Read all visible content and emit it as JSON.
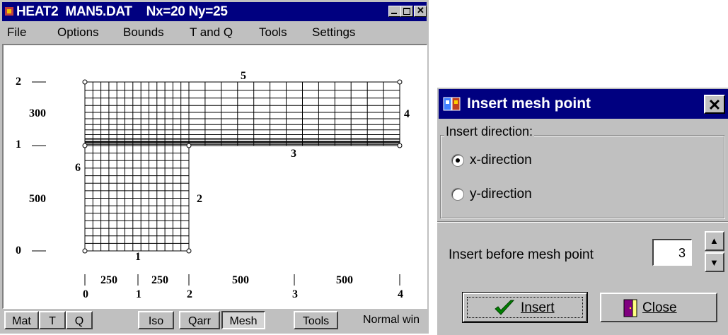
{
  "window": {
    "title": "HEAT2  MAN5.DAT    Nx=20 Ny=25",
    "icons": [
      "app-icon",
      "minimize-icon",
      "maximize-icon",
      "close-icon"
    ]
  },
  "menu": [
    "File",
    "Options",
    "Bounds",
    "T and Q",
    "Tools",
    "Settings"
  ],
  "canvas": {
    "y_labels": [
      "2",
      "300",
      "1",
      "500",
      "0"
    ],
    "x_labels": [
      "0",
      "250",
      "1",
      "250",
      "2",
      "500",
      "3",
      "500",
      "4"
    ],
    "edge_labels": [
      "5",
      "4",
      "3",
      "6",
      "2",
      "1"
    ]
  },
  "bottom_tabs": [
    "Mat",
    "T",
    "Q",
    "Iso",
    "Qarr",
    "Mesh",
    "Tools"
  ],
  "status": "Normal win",
  "dialog": {
    "title": "Insert mesh point",
    "close_label": "✕",
    "group_label": "Insert direction:",
    "radio_x": "x-direction",
    "radio_y": "y-direction",
    "selected": "x-direction",
    "insert_before_label": "Insert before mesh point",
    "mesh_point_value": "3",
    "insert_button": "Insert",
    "close_button": "Close"
  }
}
